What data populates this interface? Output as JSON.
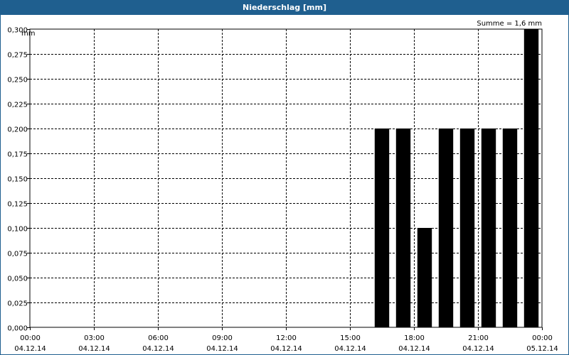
{
  "window": {
    "title": "Niederschlag [mm]"
  },
  "chart_data": {
    "type": "bar",
    "title": "Niederschlag [mm]",
    "ylabel": "mm",
    "annotation": "Summe = 1,6 mm",
    "ylim": [
      0,
      0.3
    ],
    "y_ticks": [
      "0,000",
      "0,025",
      "0,050",
      "0,075",
      "0,100",
      "0,125",
      "0,150",
      "0,175",
      "0,200",
      "0,225",
      "0,250",
      "0,275",
      "0,300"
    ],
    "x_range_hours": [
      0,
      24
    ],
    "x_ticks": [
      {
        "time": "00:00",
        "date": "04.12.14"
      },
      {
        "time": "03:00",
        "date": "04.12.14"
      },
      {
        "time": "06:00",
        "date": "04.12.14"
      },
      {
        "time": "09:00",
        "date": "04.12.14"
      },
      {
        "time": "12:00",
        "date": "04.12.14"
      },
      {
        "time": "15:00",
        "date": "04.12.14"
      },
      {
        "time": "18:00",
        "date": "04.12.14"
      },
      {
        "time": "21:00",
        "date": "04.12.14"
      },
      {
        "time": "00:00",
        "date": "05.12.14"
      }
    ],
    "bar_color": "#000000",
    "grid": true,
    "bars": [
      {
        "time": "16:30",
        "value": 0.2
      },
      {
        "time": "17:30",
        "value": 0.2
      },
      {
        "time": "18:30",
        "value": 0.1
      },
      {
        "time": "19:30",
        "value": 0.2
      },
      {
        "time": "20:30",
        "value": 0.2
      },
      {
        "time": "21:30",
        "value": 0.2
      },
      {
        "time": "22:30",
        "value": 0.2
      },
      {
        "time": "23:30",
        "value": 0.3
      }
    ]
  }
}
